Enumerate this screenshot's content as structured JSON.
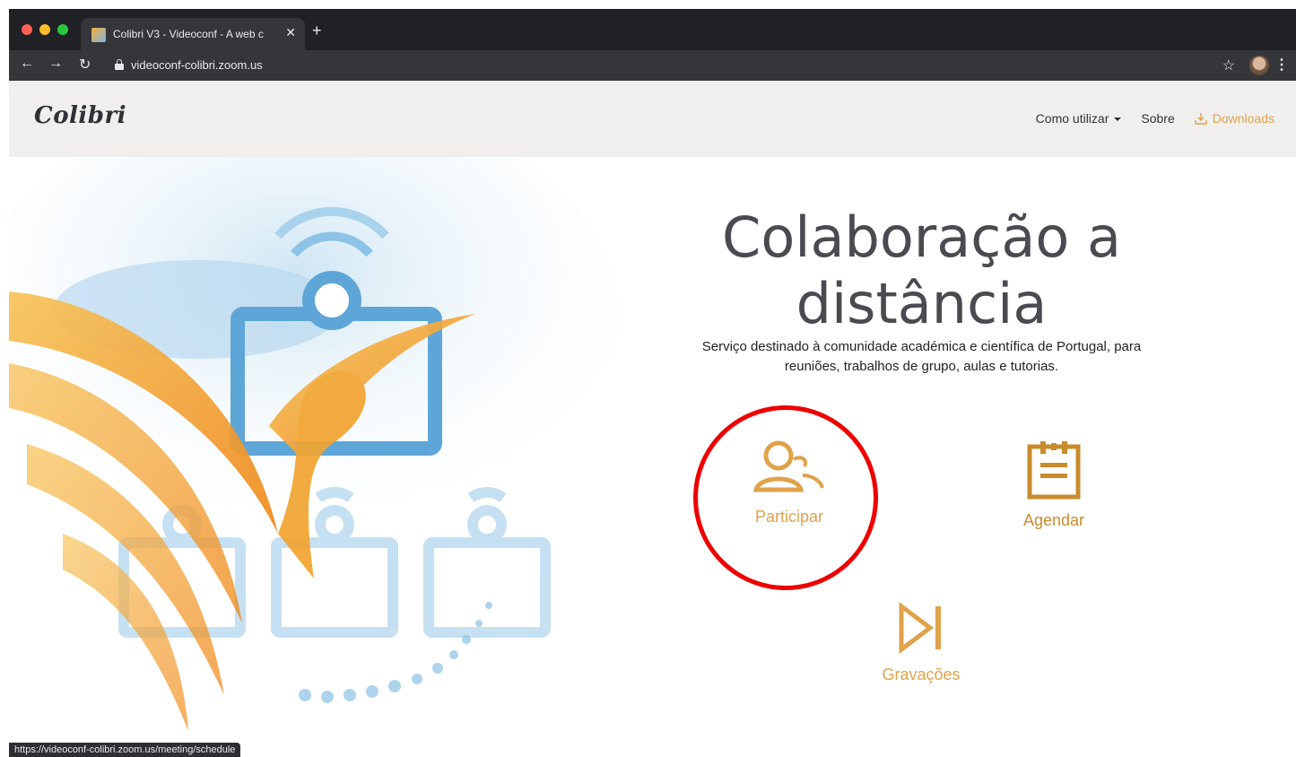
{
  "browser": {
    "tab_title": "Colibri V3 - Videoconf - A web c",
    "new_tab": "+",
    "close": "✕",
    "url": "videoconf-colibri.zoom.us",
    "status_url": "https://videoconf-colibri.zoom.us/meeting/schedule"
  },
  "navbar": {
    "logo": "Colibri",
    "menu_como": "Como utilizar",
    "menu_sobre": "Sobre",
    "menu_downloads": "Downloads"
  },
  "hero": {
    "title_line1": "Colaboração a",
    "title_line2": "distância",
    "subtitle_line1": "Serviço destinado à comunidade académica e científica de Portugal, para",
    "subtitle_line2": "reuniões, trabalhos de grupo, aulas e tutorias."
  },
  "actions": {
    "participar": "Participar",
    "agendar": "Agendar",
    "gravacoes": "Gravações"
  },
  "colors": {
    "accent": "#e0a24a",
    "highlight": "#ee0000",
    "chrome": "#202124"
  }
}
